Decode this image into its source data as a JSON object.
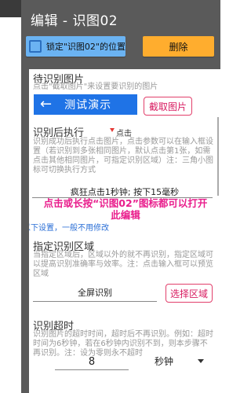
{
  "dialog": {
    "title": "编辑 - 识图02",
    "lock_label": "锁定\"识图02\"的位置",
    "delete_label": "删除"
  },
  "recognize": {
    "header": "待识别图片",
    "hint": "点击\"截取图片\"来设置要识别的图片",
    "demo_label": "测试演示",
    "capture_label": "截取图片"
  },
  "trigger": {
    "header": "识别后执行",
    "mode": "点击",
    "hint": "识别成功后执行点击图片，点击参数可以在输入框设置（若识别到多张相同图片，默认点击第1张，如需点击其他相同图片，可指定识别区域）注：三角小图标可切换执行方式",
    "action_summary": "疯狂点击1秒钟; 按下15毫秒"
  },
  "overlay": {
    "message": "点击或长按“识图02”图标都可以打开此编辑",
    "sub": "以下设置，一般不用修改"
  },
  "region": {
    "header": "指定识别区域",
    "hint": "当指定区域后，区域以外的就不再识别，指定区域可以提高识别准确率与效率。注：点击输入框可以预览区域",
    "value": "全屏识别",
    "select_label": "选择区域"
  },
  "timeout": {
    "header": "识别超时",
    "hint": "识别图片的超时时间，超时后不再识别。例如：超时时间为6秒钟，若在6秒钟内识别不到，则本步骤不再识别。注：设为零则永不超时",
    "value": "8",
    "unit": "秒钟"
  },
  "side_handle": {
    "top": "▶",
    "bottom": "✕"
  }
}
